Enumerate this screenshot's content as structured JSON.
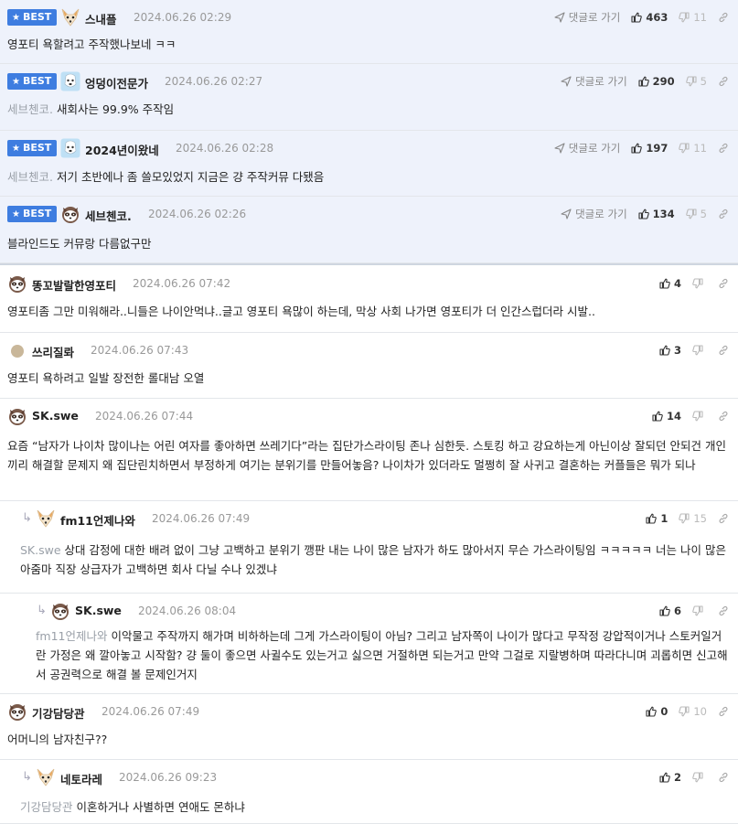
{
  "comments": [
    {
      "best": true,
      "badge": "BEST",
      "nick": "스내플",
      "avatar": "fox",
      "date": "2024.06.26 02:29",
      "goto": "댓글로 가기",
      "up": "463",
      "down": "11",
      "mention": "",
      "text": "영포티 욕할려고 주작했나보네 ㅋㅋ"
    },
    {
      "best": true,
      "badge": "BEST",
      "nick": "엉덩이전문가",
      "avatar": "dog",
      "date": "2024.06.26 02:27",
      "goto": "댓글로 가기",
      "up": "290",
      "down": "5",
      "mention": "세브첸코.",
      "text": "새회사는 99.9% 주작임"
    },
    {
      "best": true,
      "badge": "BEST",
      "nick": "2024년이왔네",
      "avatar": "dog",
      "date": "2024.06.26 02:28",
      "goto": "댓글로 가기",
      "up": "197",
      "down": "11",
      "mention": "세브첸코.",
      "text": "저기 초반에나 좀 쓸모있었지 지금은 걍 주작커뮤 다됐음"
    },
    {
      "best": true,
      "badge": "BEST",
      "nick": "세브첸코.",
      "avatar": "raccoon",
      "date": "2024.06.26 02:26",
      "goto": "댓글로 가기",
      "up": "134",
      "down": "5",
      "mention": "",
      "text": "블라인드도 커뮤랑 다름없구만"
    },
    {
      "best": false,
      "nick": "똥꼬발랄한영포티",
      "avatar": "raccoon",
      "date": "2024.06.26 07:42",
      "up": "4",
      "down": "",
      "mention": "",
      "text": "영포티좀 그만 미워해라..니들은 나이안먹냐..글고 영포티 욕많이 하는데, 막상 사회 나가면 영포티가 더 인간스럽더라 시발.."
    },
    {
      "best": false,
      "nick": "쓰리질롸",
      "avatar": "dot",
      "date": "2024.06.26 07:43",
      "up": "3",
      "down": "",
      "mention": "",
      "text": "영포티 욕하려고 일발 장전한 롤대남 오열"
    },
    {
      "best": false,
      "nick": "SK.swe",
      "avatar": "raccoon",
      "date": "2024.06.26 07:44",
      "up": "14",
      "down": "",
      "mention": "",
      "text": "요즘 “남자가 나이차 많이나는 어린 여자를 좋아하면 쓰레기다”라는 집단가스라이팅 존나 심한듯. 스토킹 하고 강요하는게 아닌이상 잘되던 안되건 개인끼리 해결할 문제지 왜 집단린치하면서 부정하게 여기는 분위기를 만들어놓음? 나이차가 있더라도 멀쩡히 잘 사귀고 결혼하는 커플들은 뭐가 되나"
    },
    {
      "best": false,
      "nick": "fm11언제나와",
      "avatar": "fox",
      "date": "2024.06.26 07:49",
      "up": "1",
      "down": "15",
      "mention": "SK.swe",
      "text": "상대 감정에 대한 배려 없이 그냥 고백하고 분위기 깽판 내는 나이 많은 남자가 하도 많아서지 무슨 가스라이팅임 ㅋㅋㅋㅋㅋ 너는 나이 많은 아줌마 직장 상급자가 고백하면 회사 다닐 수나 있겠냐"
    },
    {
      "best": false,
      "nick": "SK.swe",
      "avatar": "raccoon",
      "date": "2024.06.26 08:04",
      "up": "6",
      "down": "",
      "mention": "fm11언제나와",
      "text": "이악물고 주작까지 해가며 비하하는데 그게 가스라이팅이 아님? 그리고 남자쪽이 나이가 많다고 무작정 강압적이거나 스토커일거란 가정은 왜 깔아놓고 시작함? 걍 둘이 좋으면 사귈수도 있는거고 싫으면 거절하면 되는거고 만약 그걸로 지랄병하며 따라다니며 괴롭히면 신고해서 공권력으로 해결 볼 문제인거지"
    },
    {
      "best": false,
      "nick": "기강담당관",
      "avatar": "raccoon",
      "date": "2024.06.26 07:49",
      "up": "0",
      "down": "10",
      "mention": "",
      "text": "어머니의 남자친구??"
    },
    {
      "best": false,
      "nick": "네토라레",
      "avatar": "fox",
      "date": "2024.06.26 09:23",
      "up": "2",
      "down": "",
      "mention": "기강담당관",
      "text": "이혼하거나 사별하면 연애도 몬하냐"
    }
  ],
  "colors": {
    "badge": "#3e7de0",
    "best_bg": "#eef2fb"
  }
}
